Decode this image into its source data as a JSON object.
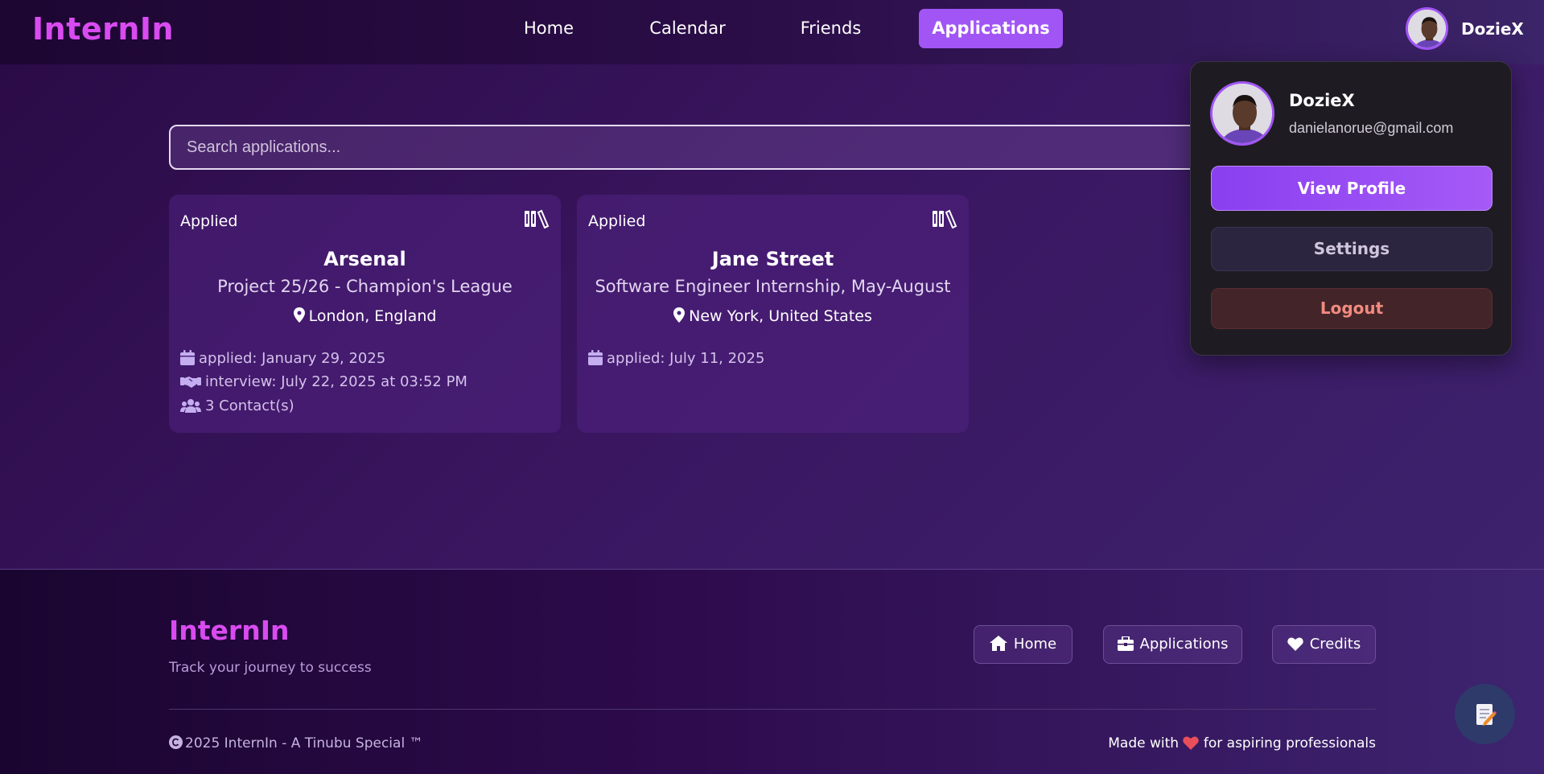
{
  "app": {
    "logo": "InternIn"
  },
  "nav": {
    "links": [
      {
        "label": "Home"
      },
      {
        "label": "Calendar"
      },
      {
        "label": "Friends"
      },
      {
        "label": "Applications"
      }
    ],
    "active": "Applications",
    "user_name": "DozieX"
  },
  "search": {
    "placeholder": "Search applications..."
  },
  "applications": [
    {
      "status": "Applied",
      "company": "Arsenal",
      "role": "Project 25/26 - Champion's League",
      "location": "London, England",
      "applied": "applied: January 29, 2025",
      "interview": "interview: July 22, 2025 at 03:52 PM",
      "contacts": "3 Contact(s)"
    },
    {
      "status": "Applied",
      "company": "Jane Street",
      "role": "Software Engineer Internship, May-August",
      "location": "New York, United States",
      "applied": "applied: July 11, 2025"
    }
  ],
  "profile_menu": {
    "name": "DozieX",
    "email": "danielanorue@gmail.com",
    "view_profile": "View Profile",
    "settings": "Settings",
    "logout": "Logout"
  },
  "footer": {
    "logo": "InternIn",
    "tagline": "Track your journey to success",
    "links": [
      {
        "label": "Home",
        "icon": "home-icon"
      },
      {
        "label": "Applications",
        "icon": "briefcase-icon"
      },
      {
        "label": "Credits",
        "icon": "heart-icon"
      }
    ],
    "copyright": "2025 InternIn - A Tinubu Special ™",
    "made_with_prefix": "Made with",
    "made_with_suffix": "for aspiring professionals"
  },
  "colors": {
    "accent": "#a155f5",
    "logo": "#d94bf0",
    "logout": "#f28a80"
  }
}
